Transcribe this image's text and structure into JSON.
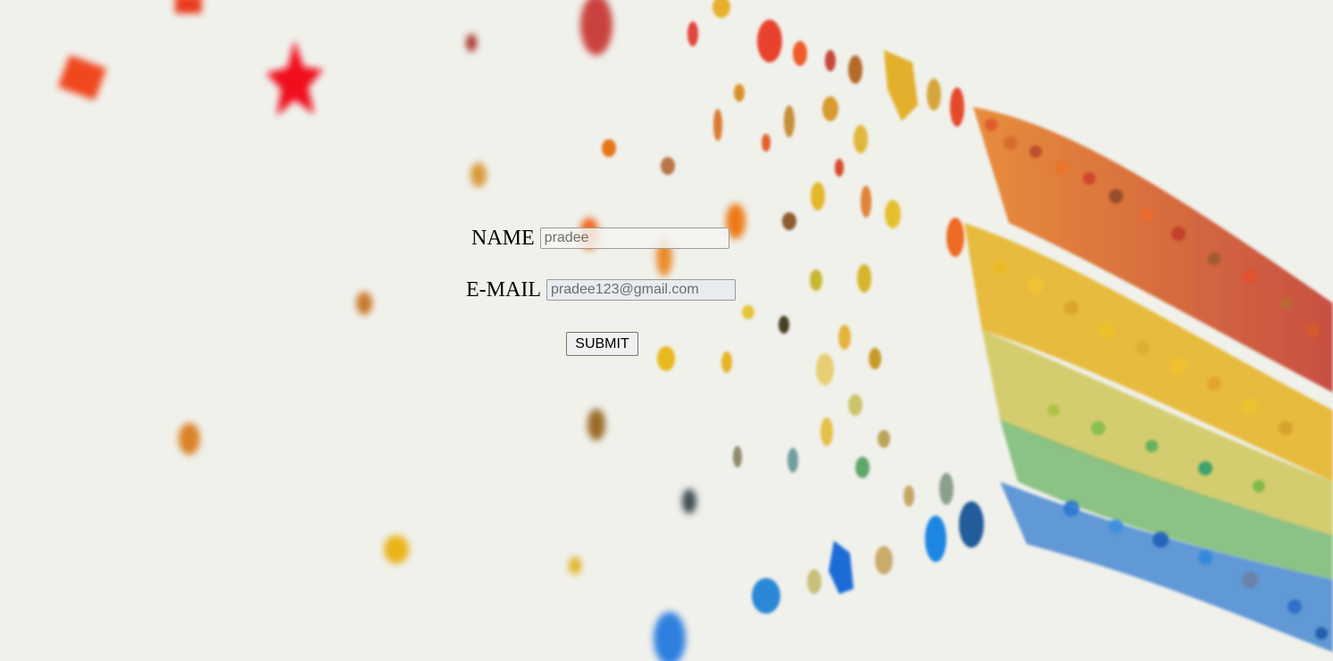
{
  "form": {
    "name_label": "NAME",
    "name_value": "pradee",
    "email_label": "E-MAIL",
    "email_value": "pradee123@gmail.com",
    "submit_label": "SUBMIT"
  },
  "background": {
    "description_colors": [
      "#e8392a",
      "#f39c12",
      "#f1c40f",
      "#8bc34a",
      "#3498db",
      "#2c7be5"
    ],
    "base_color": "#f1f1ec"
  }
}
